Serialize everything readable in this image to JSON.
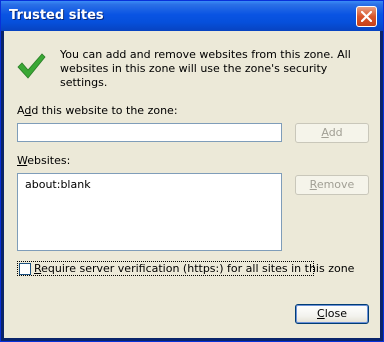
{
  "window": {
    "title": "Trusted sites",
    "close_icon": "close-x-icon"
  },
  "info": {
    "icon": "green-checkmark-icon",
    "text": "You can add and remove websites from this zone. All websites in this zone will use the zone's security settings."
  },
  "add": {
    "label_prefix": "A",
    "label_access": "d",
    "label_rest": "d this website to the zone:",
    "input_value": "",
    "button_access": "A",
    "button_rest": "dd"
  },
  "websites": {
    "label_prefix": "",
    "label_access": "W",
    "label_rest": "ebsites:",
    "items": [
      "about:blank"
    ],
    "remove_access": "R",
    "remove_rest": "emove"
  },
  "verify": {
    "checked": false,
    "label_access": "R",
    "label_rest": "equire server verification (https:) for all sites in this zone"
  },
  "footer": {
    "close_access": "C",
    "close_rest": "lose"
  },
  "colors": {
    "titlebar": "#0a54e3",
    "dialog_bg": "#ece9d8",
    "checkmark": "#3aa835"
  }
}
